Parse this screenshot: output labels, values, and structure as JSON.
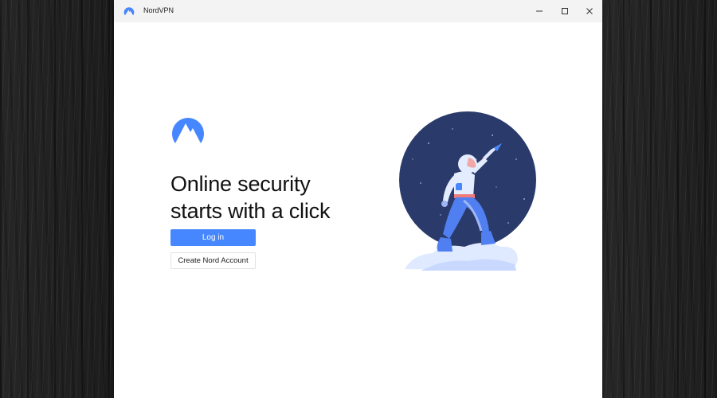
{
  "window": {
    "title": "NordVPN",
    "controls": {
      "minimize_icon": "minimize-icon",
      "maximize_icon": "maximize-icon",
      "close_icon": "close-icon"
    }
  },
  "main": {
    "headline_line1": "Online security",
    "headline_line2": "starts with a click",
    "login_label": "Log in",
    "create_account_label": "Create Nord Account"
  },
  "colors": {
    "accent": "#4687ff",
    "illustration_bg": "#2a3a6a",
    "window_bg": "#ffffff",
    "titlebar_bg": "#f3f3f3"
  }
}
